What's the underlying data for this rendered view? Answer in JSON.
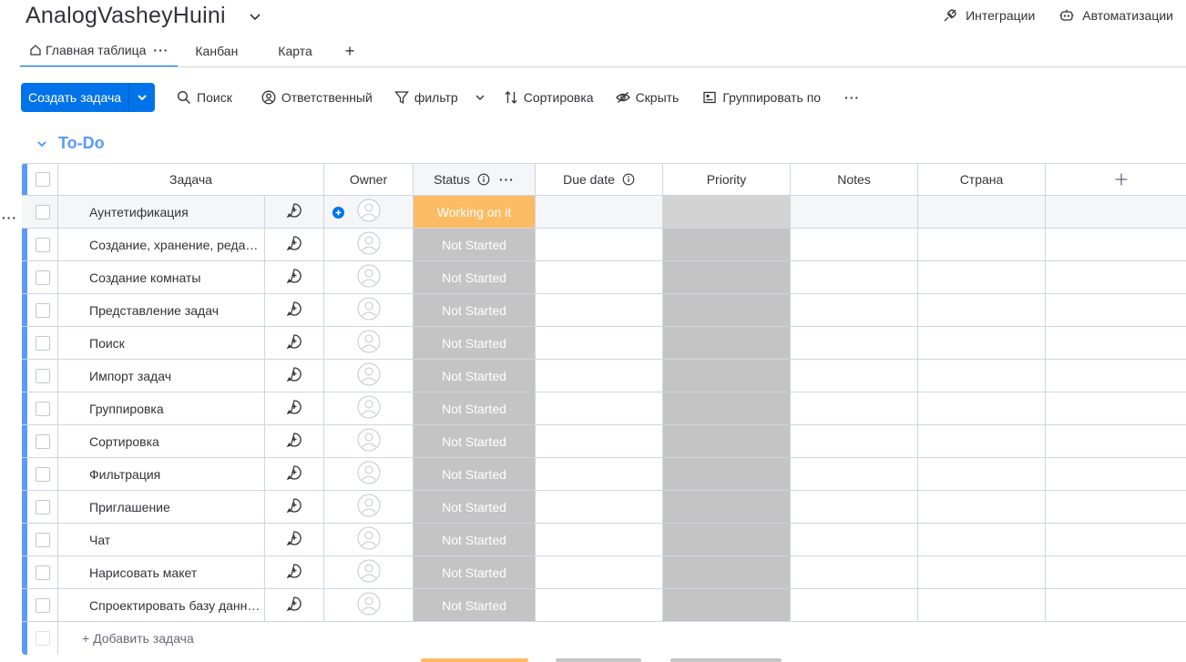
{
  "board": {
    "title": "AnalogVasheyHuini"
  },
  "top_actions": [
    {
      "label": "Интеграции",
      "icon": "integrations-icon"
    },
    {
      "label": "Автоматизации",
      "icon": "robot-icon"
    }
  ],
  "views": [
    {
      "label": "Главная таблица",
      "active": true
    },
    {
      "label": "Канбан"
    },
    {
      "label": "Карта"
    }
  ],
  "toolbar": {
    "new_item": "Создать задача",
    "search": "Поиск",
    "person": "Ответственный",
    "filter": "фильтр",
    "sort": "Сортировка",
    "hide": "Скрыть",
    "group_by": "Группировать по"
  },
  "group": {
    "title": "To-Do",
    "color": "#579bfc"
  },
  "columns": {
    "task": "Задача",
    "owner": "Owner",
    "status": "Status",
    "due": "Due date",
    "priority": "Priority",
    "notes": "Notes",
    "country": "Страна"
  },
  "rows": [
    {
      "task": "Аунтетификация",
      "status": "Working on it"
    },
    {
      "task": "Создание, хранение, редактирование",
      "status": "Not Started"
    },
    {
      "task": "Создание комнаты",
      "status": "Not Started"
    },
    {
      "task": "Представление задач",
      "status": "Not Started"
    },
    {
      "task": "Поиск",
      "status": "Not Started"
    },
    {
      "task": "Импорт задач",
      "status": "Not Started"
    },
    {
      "task": "Группировка",
      "status": "Not Started"
    },
    {
      "task": "Сортировка",
      "status": "Not Started"
    },
    {
      "task": "Фильтрация",
      "status": "Not Started"
    },
    {
      "task": "Приглашение",
      "status": "Not Started"
    },
    {
      "task": "Чат",
      "status": "Not Started"
    },
    {
      "task": "Нарисовать макет",
      "status": "Not Started"
    },
    {
      "task": "Спроектировать базу данных",
      "status": "Not Started"
    }
  ],
  "add_item": "+ Добавить задача",
  "colors": {
    "primary": "#0073ea",
    "working": "#fdbc64",
    "not_started": "#c4c4c4"
  }
}
